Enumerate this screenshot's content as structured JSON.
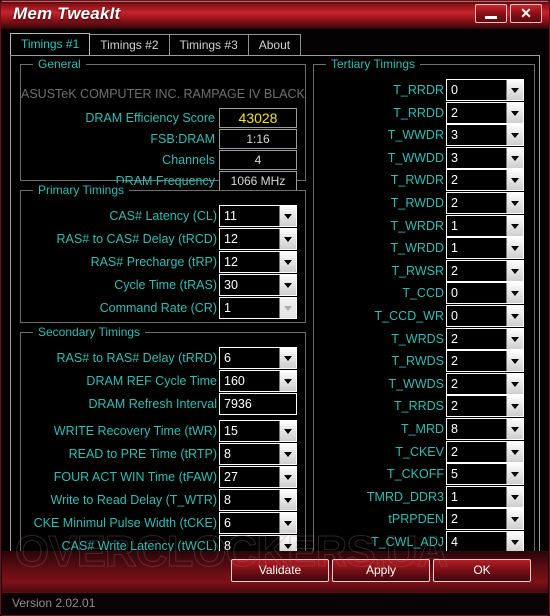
{
  "window": {
    "title": "Mem TweakIt",
    "minimize_label": "minimize",
    "close_label": "close"
  },
  "tabs": [
    {
      "label": "Timings #1",
      "active": true
    },
    {
      "label": "Timings #2",
      "active": false
    },
    {
      "label": "Timings #3",
      "active": false
    },
    {
      "label": "About",
      "active": false
    }
  ],
  "general": {
    "title": "General",
    "board": "ASUSTeK COMPUTER INC. RAMPAGE IV BLACK EDITION",
    "accent_color": "#f2e511",
    "rows": [
      {
        "label": "DRAM Efficiency Score",
        "value": "43028",
        "accent": true
      },
      {
        "label": "FSB:DRAM",
        "value": "1:16",
        "accent": false
      },
      {
        "label": "Channels",
        "value": "4",
        "accent": false
      },
      {
        "label": "DRAM Frequency",
        "value": "1066 MHz",
        "accent": false
      }
    ]
  },
  "primary": {
    "title": "Primary Timings",
    "rows": [
      {
        "label": "CAS# Latency (CL)",
        "value": "11",
        "disabled": false
      },
      {
        "label": "RAS# to CAS# Delay (tRCD)",
        "value": "12",
        "disabled": false
      },
      {
        "label": "RAS# Precharge (tRP)",
        "value": "12",
        "disabled": false
      },
      {
        "label": "Cycle Time (tRAS)",
        "value": "30",
        "disabled": false
      },
      {
        "label": "Command Rate (CR)",
        "value": "1",
        "disabled": true
      }
    ]
  },
  "secondary": {
    "title": "Secondary Timings",
    "rows": [
      {
        "label": "RAS# to RAS# Delay (tRRD)",
        "value": "6",
        "type": "combo"
      },
      {
        "label": "DRAM REF Cycle Time",
        "value": "160",
        "type": "combo"
      },
      {
        "label": "DRAM Refresh Interval",
        "value": "7936",
        "type": "text"
      },
      {
        "label": "WRITE Recovery Time (tWR)",
        "value": "15",
        "type": "combo"
      },
      {
        "label": "READ to PRE Time (tRTP)",
        "value": "8",
        "type": "combo"
      },
      {
        "label": "FOUR ACT WIN Time (tFAW)",
        "value": "27",
        "type": "combo"
      },
      {
        "label": "Write to Read Delay (T_WTR)",
        "value": "8",
        "type": "combo"
      },
      {
        "label": "CKE Minimul Pulse Width (tCKE)",
        "value": "6",
        "type": "combo"
      },
      {
        "label": "CAS# Write Latency (tWCL)",
        "value": "8",
        "type": "combo"
      }
    ]
  },
  "tertiary": {
    "title": "Tertiary Timings",
    "rows": [
      {
        "label": "T_RRDR",
        "value": "0"
      },
      {
        "label": "T_RRDD",
        "value": "2"
      },
      {
        "label": "T_WWDR",
        "value": "3"
      },
      {
        "label": "T_WWDD",
        "value": "3"
      },
      {
        "label": "T_RWDR",
        "value": "2"
      },
      {
        "label": "T_RWDD",
        "value": "2"
      },
      {
        "label": "T_WRDR",
        "value": "1"
      },
      {
        "label": "T_WRDD",
        "value": "1"
      },
      {
        "label": "T_RWSR",
        "value": "2"
      },
      {
        "label": "T_CCD",
        "value": "0"
      },
      {
        "label": "T_CCD_WR",
        "value": "0"
      },
      {
        "label": "T_WRDS",
        "value": "2"
      },
      {
        "label": "T_RWDS",
        "value": "2"
      },
      {
        "label": "T_WWDS",
        "value": "2"
      },
      {
        "label": "T_RRDS",
        "value": "2"
      },
      {
        "label": "T_MRD",
        "value": "8"
      },
      {
        "label": "T_CKEV",
        "value": "2"
      },
      {
        "label": "T_CKOFF",
        "value": "5"
      },
      {
        "label": "TMRD_DDR3",
        "value": "1"
      },
      {
        "label": "tPRPDEN",
        "value": "2"
      },
      {
        "label": "T_CWL_ADJ",
        "value": "4"
      }
    ]
  },
  "footer": {
    "buttons": [
      {
        "label": "Validate"
      },
      {
        "label": "Apply"
      },
      {
        "label": "OK"
      }
    ]
  },
  "statusbar": {
    "version": "Version 2.02.01"
  },
  "watermark": {
    "text": "OVERCLOCKERS.UA"
  }
}
